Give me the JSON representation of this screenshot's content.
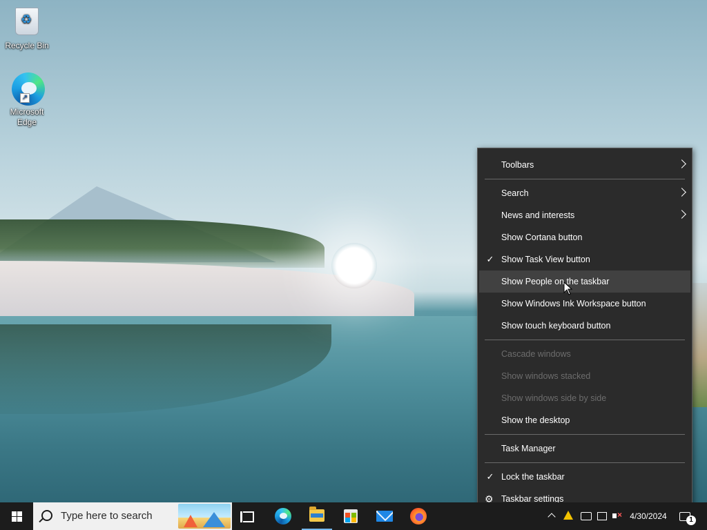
{
  "desktop": {
    "icons": [
      {
        "label": "Recycle Bin",
        "icon": "recycle-bin-icon"
      },
      {
        "label": "Microsoft Edge",
        "icon": "edge-icon"
      }
    ]
  },
  "context_menu": {
    "groups": [
      [
        {
          "label": "Toolbars",
          "submenu": true,
          "checked": false,
          "disabled": false
        }
      ],
      [
        {
          "label": "Search",
          "submenu": true,
          "checked": false,
          "disabled": false
        },
        {
          "label": "News and interests",
          "submenu": true,
          "checked": false,
          "disabled": false
        },
        {
          "label": "Show Cortana button",
          "submenu": false,
          "checked": false,
          "disabled": false
        },
        {
          "label": "Show Task View button",
          "submenu": false,
          "checked": true,
          "disabled": false
        },
        {
          "label": "Show People on the taskbar",
          "submenu": false,
          "checked": false,
          "disabled": false,
          "hovered": true
        },
        {
          "label": "Show Windows Ink Workspace button",
          "submenu": false,
          "checked": false,
          "disabled": false
        },
        {
          "label": "Show touch keyboard button",
          "submenu": false,
          "checked": false,
          "disabled": false
        }
      ],
      [
        {
          "label": "Cascade windows",
          "disabled": true
        },
        {
          "label": "Show windows stacked",
          "disabled": true
        },
        {
          "label": "Show windows side by side",
          "disabled": true
        },
        {
          "label": "Show the desktop",
          "disabled": false
        }
      ],
      [
        {
          "label": "Task Manager",
          "disabled": false
        }
      ],
      [
        {
          "label": "Lock the taskbar",
          "checked": true,
          "disabled": false
        },
        {
          "label": "Taskbar settings",
          "icon": "gear-icon",
          "disabled": false
        }
      ]
    ]
  },
  "taskbar": {
    "search_placeholder": "Type here to search",
    "pinned": [
      "task-view-icon",
      "edge-icon",
      "file-explorer-icon",
      "microsoft-store-icon",
      "mail-icon",
      "firefox-icon"
    ],
    "active_app": "file-explorer-icon",
    "tray": {
      "date": "4/30/2024",
      "notification_count": "1"
    }
  },
  "colors": {
    "menu_bg": "#2b2b2b",
    "menu_hover": "#414141",
    "menu_disabled_text": "#6d6d6d",
    "taskbar_bg": "#1c1c1c",
    "active_indicator": "#76b9ed"
  }
}
